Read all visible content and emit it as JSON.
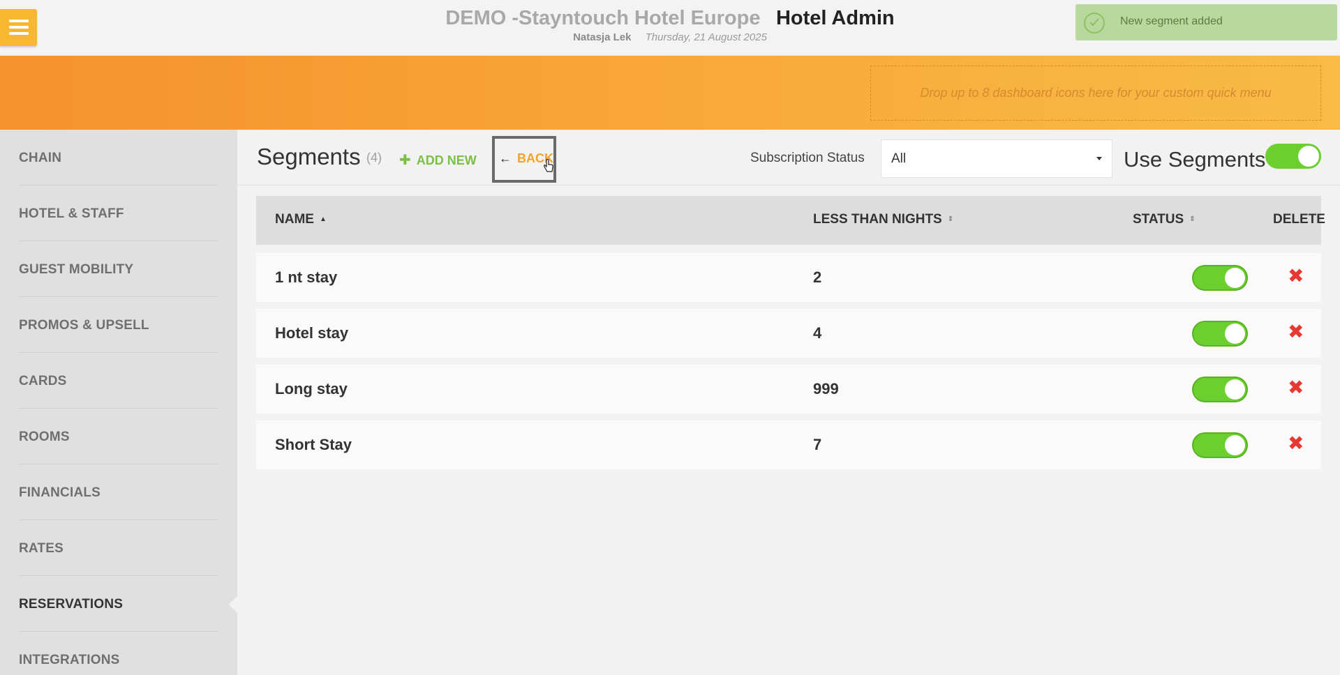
{
  "header": {
    "hotel_name": "DEMO -Stayntouch Hotel Europe",
    "app_name": "Hotel Admin",
    "user": "Natasja Lek",
    "date": "Thursday, 21 August 2025"
  },
  "toast": {
    "message": "New segment added"
  },
  "quick_menu": {
    "placeholder": "Drop up to 8 dashboard icons here for your custom quick menu"
  },
  "sidebar": {
    "items": [
      {
        "label": "CHAIN"
      },
      {
        "label": "HOTEL & STAFF"
      },
      {
        "label": "GUEST MOBILITY"
      },
      {
        "label": "PROMOS & UPSELL"
      },
      {
        "label": "CARDS"
      },
      {
        "label": "ROOMS"
      },
      {
        "label": "FINANCIALS"
      },
      {
        "label": "RATES"
      },
      {
        "label": "RESERVATIONS"
      },
      {
        "label": "INTEGRATIONS"
      }
    ],
    "active": "RESERVATIONS"
  },
  "toolbar": {
    "title": "Segments",
    "count": "(4)",
    "add_new": "ADD NEW",
    "back": "BACK",
    "subscription_label": "Subscription Status",
    "subscription_value": "All",
    "use_segments_label": "Use Segments",
    "use_segments_on": true
  },
  "table": {
    "columns": {
      "name": "NAME",
      "nights": "LESS THAN NIGHTS",
      "status": "STATUS",
      "delete": "DELETE"
    },
    "rows": [
      {
        "name": "1 nt stay",
        "nights": "2",
        "status": true
      },
      {
        "name": "Hotel stay",
        "nights": "4",
        "status": true
      },
      {
        "name": "Long stay",
        "nights": "999",
        "status": true
      },
      {
        "name": "Short Stay",
        "nights": "7",
        "status": true
      }
    ]
  },
  "colors": {
    "accent_orange": "#f7a533",
    "toggle_green": "#6bcf2f",
    "delete_red": "#e53935",
    "add_green": "#7bc043"
  }
}
